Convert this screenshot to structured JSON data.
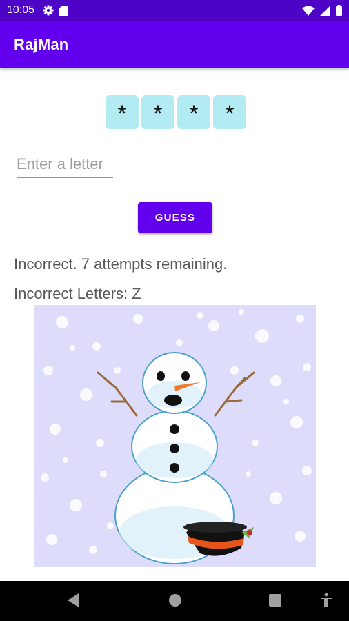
{
  "status_bar": {
    "time": "10:05",
    "left_icons": [
      "gear-icon",
      "sd-card-icon"
    ],
    "right_icons": [
      "wifi-icon",
      "signal-icon",
      "battery-icon"
    ]
  },
  "app_bar": {
    "title": "RajMan"
  },
  "word_tiles": [
    "*",
    "*",
    "*",
    "*"
  ],
  "letter_input": {
    "placeholder": "Enter a letter",
    "value": ""
  },
  "guess_button": {
    "label": "GUESS"
  },
  "messages": {
    "status": "Incorrect. 7 attempts remaining.",
    "incorrect_letters": "Incorrect Letters: Z"
  },
  "nav_bar": {
    "buttons": [
      "back-icon",
      "home-icon",
      "recents-icon",
      "accessibility-icon"
    ]
  },
  "colors": {
    "status_bar": "#4e04c6",
    "app_bar": "#6200ee",
    "tile": "#b3ebf2",
    "input_underline": "#26c6c6",
    "snow_background": "#dedcfb"
  }
}
